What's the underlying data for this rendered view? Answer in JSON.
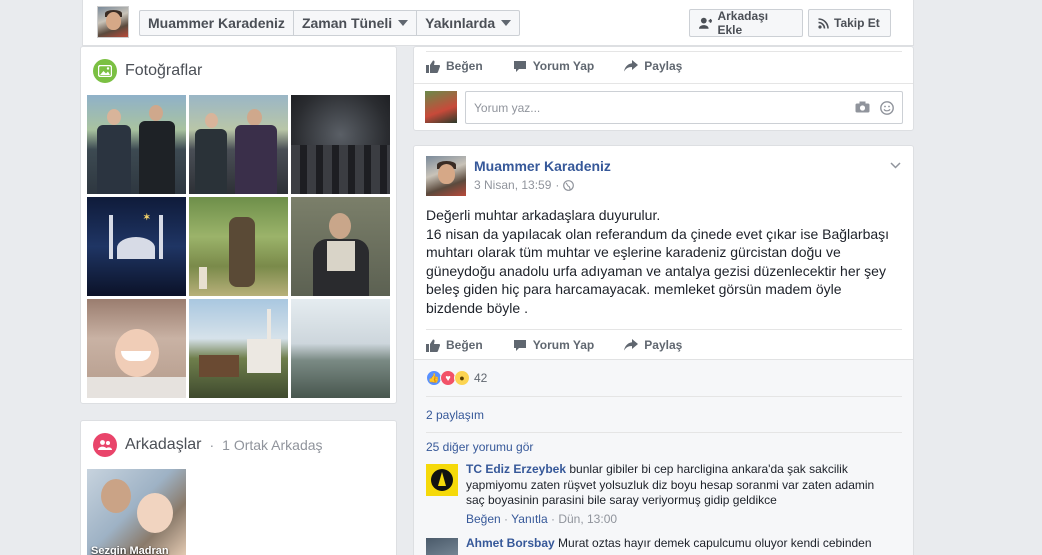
{
  "header": {
    "profile_name": "Muammer Karadeniz",
    "nav": [
      {
        "label": "Muammer Karadeniz"
      },
      {
        "label": "Zaman Tüneli"
      },
      {
        "label": "Yakınlarda"
      }
    ],
    "add_friend_label": "Arkadaşı Ekle",
    "follow_label": "Takip Et"
  },
  "photos": {
    "title": "Fotoğraflar"
  },
  "friends": {
    "title": "Arkadaşlar",
    "mutual": "1 Ortak Arkadaş",
    "first_friend_name": "Sezgin Madran"
  },
  "post_actions": {
    "like": "Beğen",
    "comment": "Yorum Yap",
    "share": "Paylaş"
  },
  "top_comment_box": {
    "placeholder": "Yorum yaz..."
  },
  "post": {
    "author": "Muammer Karadeniz",
    "time": "3 Nisan, 13:59",
    "separator": "·",
    "text_lines": [
      "Değerli muhtar arkadaşlara duyurulur.",
      "16 nisan da yapılacak olan referandum da çinede evet çıkar ise Bağlarbaşı",
      "muhtarı olarak tüm muhtar ve eşlerine karadeniz gürcistan doğu ve",
      "güneydoğu anadolu urfa adıyaman ve antalya gezisi düzenlecektir her şey",
      "beleş giden hiç para harcamayacak. memleket görsün madem öyle",
      "bizdende böyle ."
    ],
    "reaction_count": "42",
    "shares": "2 paylaşım",
    "more_comments": "25 diğer yorumu gör"
  },
  "comments": [
    {
      "name": "TC Ediz Erzeybek",
      "text": "bunlar gibiler bi cep harcligina ankara'da şak sakcilik yapmiyomu zaten rüşvet yolsuzluk diz boyu hesap soranmi var zaten adamin saç boyasinin parasini bile saray veriyormuş gidip geldikce",
      "like": "Beğen",
      "reply": "Yanıtla",
      "time": "Dün, 13:00"
    },
    {
      "name": "Ahmet Borsbay",
      "text": "Murat oztas hayır demek capulcumu oluyor kendi cebinden"
    }
  ],
  "colors": {
    "link": "#365899",
    "page_bg": "#e9ebee",
    "like_blue": "#5890ff",
    "love_red": "#f25268",
    "wow_yellow": "#fcd451"
  }
}
